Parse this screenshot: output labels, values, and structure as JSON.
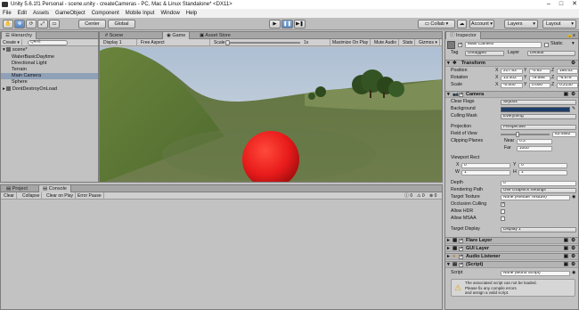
{
  "window": {
    "title": "Unity 5.6.1f1 Personal - scene.unity - createCameras - PC, Mac & Linux Standalone* <DX11>",
    "controls": [
      "–",
      "□",
      "✕"
    ]
  },
  "menu": [
    "File",
    "Edit",
    "Assets",
    "GameObject",
    "Component",
    "Mobile Input",
    "Window",
    "Help"
  ],
  "toolbar": {
    "pivot": "Center",
    "space": "Global",
    "cloud_label": "☁",
    "account": "Account ▾",
    "layers": "Layers",
    "layout": "Layout"
  },
  "hierarchy": {
    "tab": "Hierarchy",
    "create": "Create ▾",
    "search_placeholder": "Q▾All",
    "scene": "scene*",
    "items": [
      "WaterBasicDaytime",
      "Directional Light",
      "Terrain",
      "Main Camera",
      "Sphere",
      "DontDestroyOnLoad"
    ],
    "selected_index": 3
  },
  "scene_tabs": [
    "Scene",
    "Game",
    "Asset Store"
  ],
  "game_toolbar": {
    "display": "Display 1",
    "aspect": "Free Aspect",
    "scale_label": "Scale",
    "scale_value": "1x",
    "maximize": "Maximize On Play",
    "mute": "Mute Audio",
    "stats": "Stats",
    "gizmos": "Gizmos ▾"
  },
  "bottom": {
    "tabs": [
      "Project",
      "Console"
    ],
    "buttons": [
      "Clear",
      "Collapse",
      "Clear on Play",
      "Error Pause"
    ],
    "counts": [
      "0",
      "0",
      "0"
    ]
  },
  "inspector": {
    "tab": "Inspector",
    "object_name": "Main Camera",
    "static_label": "Static",
    "tag_label": "Tag",
    "tag_value": "Untagged",
    "layer_label": "Layer",
    "layer_value": "Default",
    "transform": {
      "title": "Transform",
      "position_label": "Position",
      "position": [
        "217.53",
        "-0.93",
        "186.53"
      ],
      "rotation_label": "Rotation",
      "rotation": [
        "13.402",
        "79.566",
        "-6.678"
      ],
      "scale_label": "Scale",
      "scale": [
        "-0.000",
        "0.000",
        "0.2130"
      ]
    },
    "camera": {
      "title": "Camera",
      "clear_flags_label": "Clear Flags",
      "clear_flags": "Skybox",
      "background_label": "Background",
      "background_color": "#1c3d6b",
      "culling_mask_label": "Culling Mask",
      "culling_mask": "Everything",
      "projection_label": "Projection",
      "projection": "Perspective",
      "fov_label": "Field of View",
      "fov": "63.4862",
      "fov_fraction": 0.35,
      "clipping_label": "Clipping Planes",
      "near_label": "Near",
      "near": "0.3",
      "far_label": "Far",
      "far": "1000",
      "viewport_label": "Viewport Rect",
      "vx": "0",
      "vy": "0",
      "vw": "1",
      "vh": "1",
      "depth_label": "Depth",
      "depth": "0",
      "rendering_path_label": "Rendering Path",
      "rendering_path": "Use Graphics Settings",
      "target_texture_label": "Target Texture",
      "target_texture": "None (Render Texture)",
      "occlusion_label": "Occlusion Culling",
      "hdr_label": "Allow HDR",
      "msaa_label": "Allow MSAA",
      "target_display_label": "Target Display",
      "target_display": "Display 1"
    },
    "components": [
      "Flare Layer",
      "GUI Layer",
      "Audio Listener",
      "(Script)"
    ],
    "script_label": "Script",
    "script_value": "None (Mono Script)",
    "warning": [
      "The associated script can not be loaded.",
      "Please fix any compile errors",
      "and assign a valid script."
    ]
  },
  "colors": {
    "selection": "#8fa1b8",
    "sphere": "#e81b1b",
    "play_active": "#5a86c0"
  }
}
